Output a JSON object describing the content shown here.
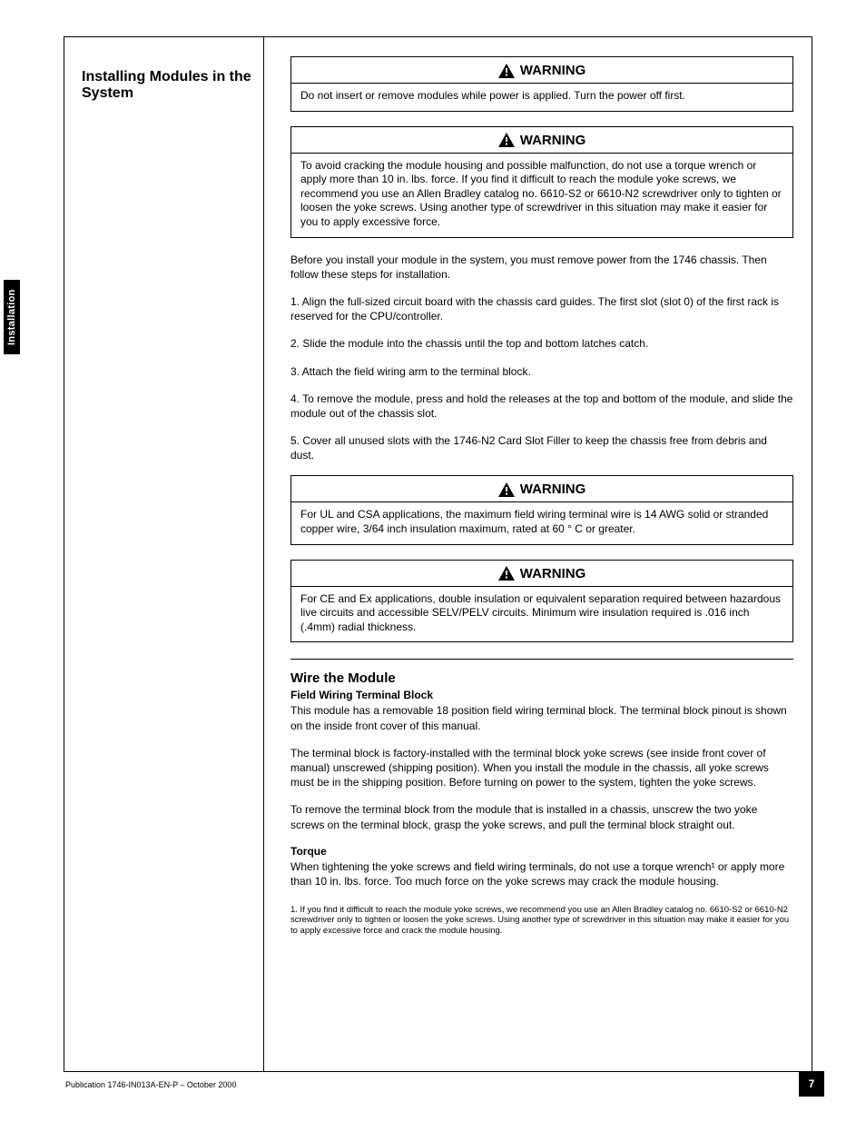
{
  "side_tab": "Installation",
  "left_title": "Installing Modules in the System",
  "warn1": {
    "label": "WARNING",
    "body": "Do not insert or remove modules while power is applied. Turn the power off first."
  },
  "warn2": {
    "label": "WARNING",
    "body": "To avoid cracking the module housing and possible malfunction, do not use a torque wrench or apply more than 10 in. lbs. force. If you find it difficult to reach the module yoke screws, we recommend you use an Allen Bradley catalog no. 6610-S2 or 6610-N2 screwdriver only to tighten or loosen the yoke screws. Using another type of screwdriver in this situation may make it easier for you to apply excessive force."
  },
  "para1": "Before you install your module in the system, you must remove power from the 1746 chassis. Then follow these steps for installation.",
  "steps": [
    "1. Align the full-sized circuit board with the chassis card guides. The first slot (slot 0) of the first rack is reserved for the CPU/controller.",
    "2. Slide the module into the chassis until the top and bottom latches catch.",
    "3. Attach the field wiring arm to the terminal block.",
    "4. To remove the module, press and hold the releases at the top and bottom of the module, and slide the module out of the chassis slot.",
    "5. Cover all unused slots with the 1746-N2 Card Slot Filler to keep the chassis free from debris and dust."
  ],
  "warn3": {
    "label": "WARNING",
    "body": "For UL and CSA applications, the maximum field wiring terminal wire is 14 AWG solid or stranded copper wire, 3/64 inch insulation maximum, rated at 60 ° C or greater."
  },
  "warn4": {
    "label": "WARNING",
    "body": "For CE and Ex applications, double insulation or equivalent separation required between hazardous live circuits and accessible SELV/PELV circuits. Minimum wire insulation required is .016 inch (.4mm) radial thickness."
  },
  "section": {
    "h1": "Wire the Module",
    "h2": "Field Wiring Terminal Block",
    "intro": "This module has a removable 18 position field wiring terminal block. The terminal block pinout is shown on the inside front cover of this manual.",
    "p2": "The terminal block is factory-installed with the terminal block yoke screws (see inside front cover of manual) unscrewed (shipping position). When you install the module in the chassis, all yoke screws must be in the shipping position. Before turning on power to the system, tighten the yoke screws.",
    "p3": "To remove the terminal block from the module that is installed in a chassis, unscrew the two yoke screws on the terminal block, grasp the yoke screws, and pull the terminal block straight out.",
    "h3": "Torque",
    "p4": "When tightening the yoke screws and field wiring terminals, do not use a torque wrench¹ or apply more than 10 in. lbs. force. Too much force on the yoke screws may crack the module housing.",
    "fn": "1. If you find it difficult to reach the module yoke screws, we recommend you use an Allen Bradley catalog no. 6610-S2 or 6610-N2 screwdriver only to tighten or loosen the yoke screws. Using another type of screwdriver in this situation may make it easier for you to apply excessive force and crack the module housing."
  },
  "pub": "Publication 1746-IN013A-EN-P – October 2000",
  "page": "7"
}
